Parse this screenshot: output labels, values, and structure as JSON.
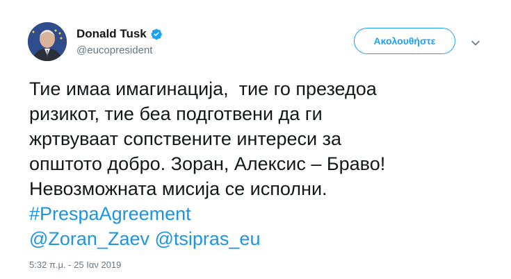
{
  "author": {
    "display_name": "Donald Tusk",
    "handle": "@eucopresident",
    "verified": true,
    "avatar_icon": "profile-photo"
  },
  "follow_button": {
    "label": "Ακολουθήστε"
  },
  "menu_icon": "chevron-down-icon",
  "tweet": {
    "lines": [
      "Тие имаа имагинација,  тие го презедоа",
      "ризикот, тие беа подготвени да ги",
      "жртвуваат сопствените интереси за",
      "општото добро. Зоран, Алексис – Браво!",
      "Невозможната мисија се исполни."
    ],
    "hashtag": "#PrespaAgreement",
    "mentions": "@Zoran_Zaev @tsipras_eu"
  },
  "timestamp": "5:32 π.μ. - 25 Ιαν 2019",
  "colors": {
    "link": "#1b95e0",
    "follow": "#1da1f2",
    "secondary_text": "#657786",
    "primary_text": "#14171a"
  }
}
